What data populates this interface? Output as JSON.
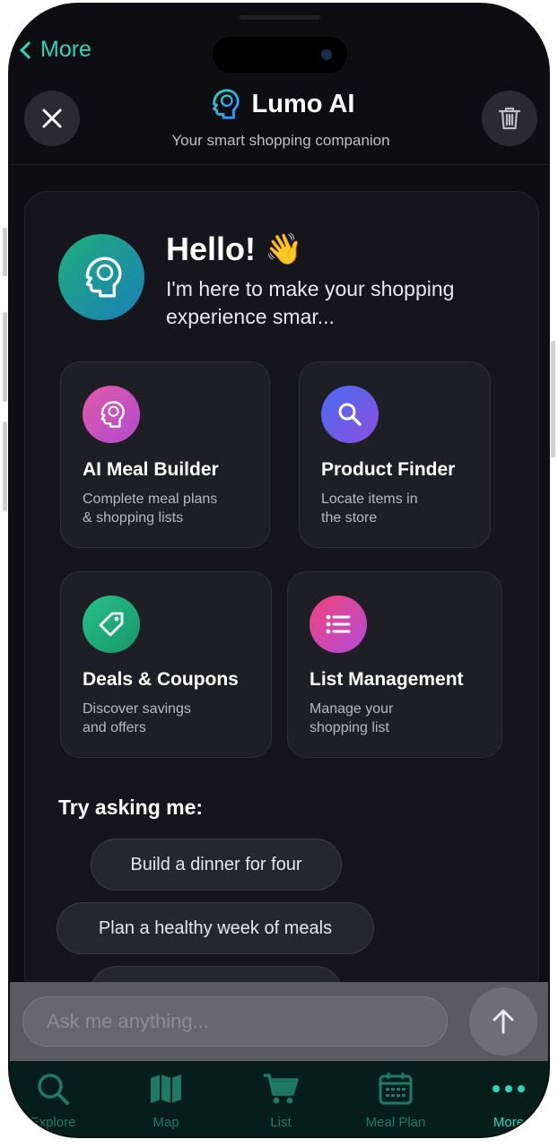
{
  "nav": {
    "back_label": "More"
  },
  "header": {
    "title": "Lumo AI",
    "subtitle": "Your smart shopping companion"
  },
  "welcome": {
    "greeting": "Hello!",
    "emoji": "👋",
    "intro": "I'm here to make your shopping experience smar..."
  },
  "features": [
    {
      "title": "AI Meal Builder",
      "desc1": "Complete meal plans",
      "desc2": "& shopping lists",
      "icon": "brain-icon",
      "color": "#d94fa8"
    },
    {
      "title": "Product Finder",
      "desc1": "Locate items in",
      "desc2": "the store",
      "icon": "search-icon",
      "color": "#6a55e0"
    },
    {
      "title": "Deals & Coupons",
      "desc1": "Discover savings",
      "desc2": "and offers",
      "icon": "tag-icon",
      "color": "#21b07a"
    },
    {
      "title": "List Management",
      "desc1": "Manage your",
      "desc2": "shopping list",
      "icon": "list-icon",
      "color": "#e04a8e"
    }
  ],
  "suggestions": {
    "heading": "Try asking me:",
    "chips": [
      "Build a dinner for four",
      "Plan a healthy week of meals"
    ]
  },
  "input": {
    "placeholder": "Ask me anything..."
  },
  "tabbar": {
    "explore": "Explore",
    "map": "Map",
    "list": "List",
    "meal_plan": "Meal Plan",
    "more": "More"
  },
  "colors": {
    "accent": "#2dd4b7",
    "background": "#0d0d12",
    "card": "#1e1e25"
  }
}
